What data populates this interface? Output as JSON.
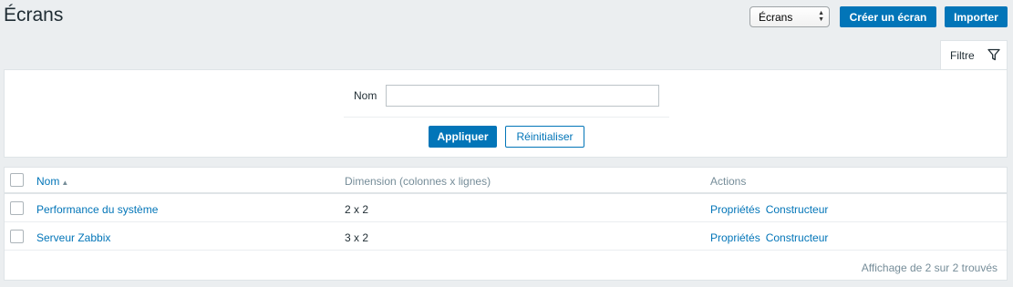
{
  "header": {
    "title": "Écrans",
    "view_select": "Écrans",
    "create_button": "Créer un écran",
    "import_button": "Importer"
  },
  "filter": {
    "tab_label": "Filtre",
    "tab_icon": "filter-funnel-icon",
    "name_label": "Nom",
    "name_value": "",
    "apply_button": "Appliquer",
    "reset_button": "Réinitialiser"
  },
  "table": {
    "columns": {
      "name": "Nom",
      "sort_indicator": "▲",
      "dimension": "Dimension (colonnes x lignes)",
      "actions": "Actions"
    },
    "rows": [
      {
        "name": "Performance du système",
        "dimension": "2 x 2",
        "action_properties": "Propriétés",
        "action_constructor": "Constructeur"
      },
      {
        "name": "Serveur Zabbix",
        "dimension": "3 x 2",
        "action_properties": "Propriétés",
        "action_constructor": "Constructeur"
      }
    ],
    "footer": "Affichage de 2 sur 2 trouvés"
  },
  "colors": {
    "accent": "#0275b8",
    "background": "#ebeef0",
    "header_text": "#768d99"
  }
}
